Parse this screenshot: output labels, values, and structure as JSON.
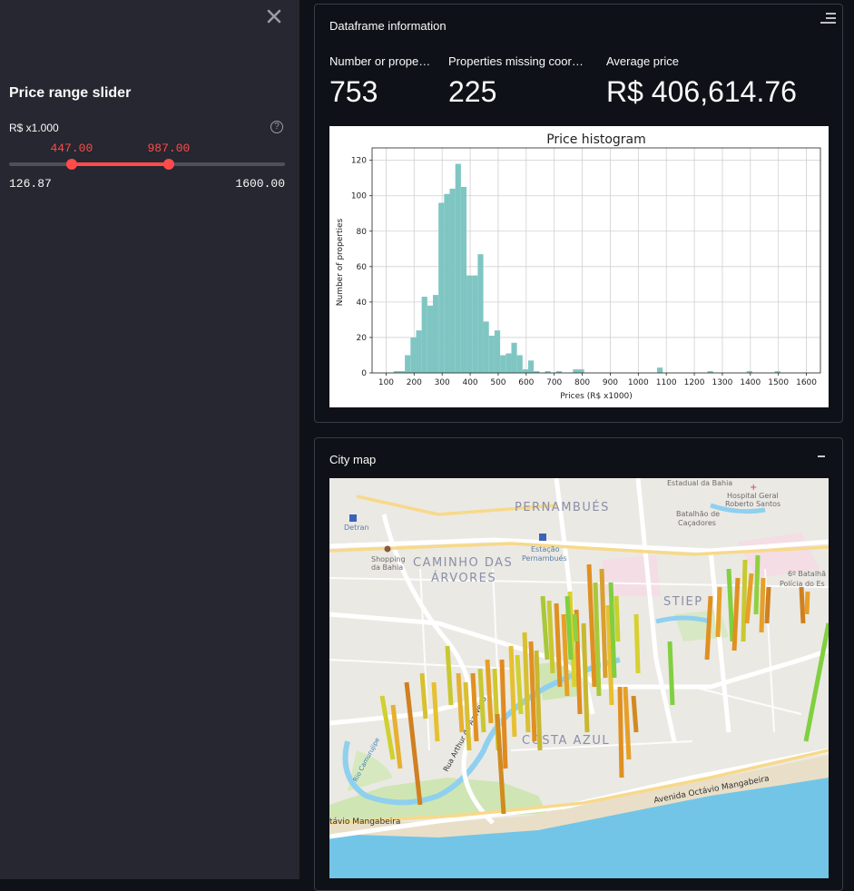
{
  "sidebar": {
    "title": "Price range slider",
    "slider": {
      "label": "R$ x1.000",
      "min_label": "126.87",
      "max_label": "1600.00",
      "min": 126.87,
      "max": 1600.0,
      "low_label": "447.00",
      "high_label": "987.00",
      "low": 447.0,
      "high": 987.0
    }
  },
  "dataframe_panel": {
    "title": "Dataframe information",
    "metrics": [
      {
        "label": "Number or prope…",
        "value": "753"
      },
      {
        "label": "Properties missing coor…",
        "value": "225"
      },
      {
        "label": "Average price",
        "value": "R$ 406,614.76"
      }
    ]
  },
  "chart_data": {
    "type": "bar",
    "title": "Price histogram",
    "xlabel": "Prices (R$ x1000)",
    "ylabel": "Number of properties",
    "xlim": [
      50,
      1650
    ],
    "ylim": [
      0,
      127
    ],
    "xticks": [
      100,
      200,
      300,
      400,
      500,
      600,
      700,
      800,
      900,
      1000,
      1100,
      1200,
      1300,
      1400,
      1500,
      1600
    ],
    "yticks": [
      0,
      20,
      40,
      60,
      80,
      100,
      120
    ],
    "grid": true,
    "bin_width": 20,
    "bins": [
      {
        "x": 127,
        "y": 1
      },
      {
        "x": 147,
        "y": 1
      },
      {
        "x": 167,
        "y": 10
      },
      {
        "x": 187,
        "y": 20
      },
      {
        "x": 207,
        "y": 24
      },
      {
        "x": 227,
        "y": 43
      },
      {
        "x": 247,
        "y": 38
      },
      {
        "x": 267,
        "y": 44
      },
      {
        "x": 287,
        "y": 96
      },
      {
        "x": 307,
        "y": 101
      },
      {
        "x": 327,
        "y": 104
      },
      {
        "x": 347,
        "y": 118
      },
      {
        "x": 367,
        "y": 105
      },
      {
        "x": 387,
        "y": 55
      },
      {
        "x": 407,
        "y": 55
      },
      {
        "x": 427,
        "y": 67
      },
      {
        "x": 447,
        "y": 29
      },
      {
        "x": 467,
        "y": 21
      },
      {
        "x": 487,
        "y": 24
      },
      {
        "x": 507,
        "y": 10
      },
      {
        "x": 527,
        "y": 11
      },
      {
        "x": 547,
        "y": 17
      },
      {
        "x": 567,
        "y": 10
      },
      {
        "x": 587,
        "y": 2
      },
      {
        "x": 607,
        "y": 7
      },
      {
        "x": 627,
        "y": 1
      },
      {
        "x": 667,
        "y": 1
      },
      {
        "x": 707,
        "y": 1
      },
      {
        "x": 767,
        "y": 2
      },
      {
        "x": 787,
        "y": 2
      },
      {
        "x": 1067,
        "y": 3
      },
      {
        "x": 1247,
        "y": 1
      },
      {
        "x": 1387,
        "y": 1
      },
      {
        "x": 1487,
        "y": 1
      }
    ],
    "bar_color": "#7fc6c3"
  },
  "map_panel": {
    "title": "City map",
    "labels": {
      "pernambues": "PERNAMBUÉS",
      "caminho1": "CAMINHO DAS",
      "caminho2": "ÁRVORES",
      "stiep": "STIEP",
      "costa": "COSTA AZUL",
      "detran": "Detran",
      "shopping1": "Shopping",
      "shopping2": "da Bahia",
      "estacao1": "Estação",
      "estacao2": "Pernambués",
      "hospital1": "Hospital Geral",
      "hospital2": "Roberto Santos",
      "estadual": "Estadual da Bahia",
      "batalhao1": "Batalhão de",
      "batalhao2": "Caçadores",
      "policia1": "6º Batalhã",
      "policia2": "Polícia do Es",
      "avenida_octavio": "Avenida Octávio Mangabeira",
      "octavio_left": "távio Mangabeira",
      "rua_arthur": "Rua Arthur de Azevedo",
      "rio": "Rio Camurujipe"
    }
  }
}
